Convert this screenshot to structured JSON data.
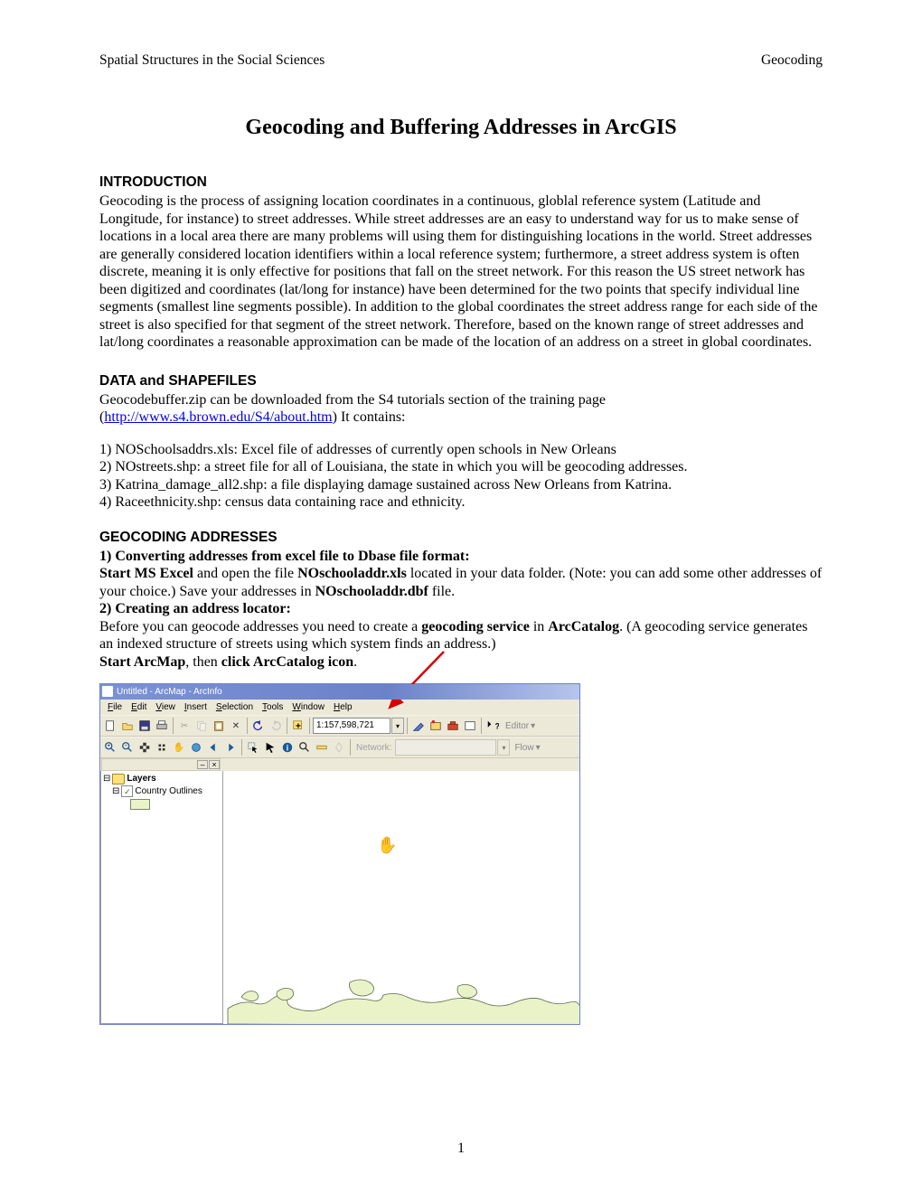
{
  "header": {
    "left": "Spatial Structures in the Social Sciences",
    "right": "Geocoding"
  },
  "title": "Geocoding and Buffering Addresses in ArcGIS",
  "intro_heading": "INTRODUCTION",
  "intro_body": "Geocoding is the process of assigning location coordinates in a continuous, globlal reference system (Latitude and Longitude, for instance) to street addresses. While street addresses are an easy to understand way for us to make sense of locations in a local area there are many problems will using them for distinguishing locations in the world. Street addresses are generally considered location identifiers within a local reference system; furthermore, a street address system is often discrete, meaning it is only effective for positions that fall on the street network. For this reason the US street network has been digitized and coordinates (lat/long for instance) have been determined for the two points that specify individual line segments (smallest line segments possible). In addition to the global coordinates the street address range for each side of the street is also specified for that segment of the street network. Therefore, based on the known range of street addresses and lat/long coordinates a reasonable approximation can be made of the location of an address on a street in global coordinates.",
  "data_heading": "DATA and SHAPEFILES",
  "data_intro_pre": "Geocodebuffer.zip can be downloaded from the S4 tutorials section of the training page (",
  "data_url": "http://www.s4.brown.edu/S4/about.htm",
  "data_intro_post": ") It contains:",
  "data_items": {
    "i1": "1) NOSchoolsaddrs.xls: Excel file of addresses of currently open schools in New Orleans",
    "i2": "2) NOstreets.shp: a street file for all of Louisiana, the state in which you will be geocoding addresses.",
    "i3": "3) Katrina_damage_all2.shp: a file displaying damage sustained across New Orleans from Katrina.",
    "i4": "4) Raceethnicity.shp: census data containing race and ethnicity."
  },
  "geo_heading": "GEOCODING ADDRESSES",
  "step1_title": "1) Converting addresses from excel file to Dbase file format:",
  "step1_b1": "Start MS Excel",
  "step1_t1": " and open the file ",
  "step1_b2": "NOschooladdr.xls",
  "step1_t2": " located in your data folder. (Note: you can add some other addresses of your choice.) Save your addresses in ",
  "step1_b3": "NOschooladdr.dbf",
  "step1_t3": " file.",
  "step2_title": "2) Creating an address locator:",
  "step2_pre": "Before you can geocode addresses you need to create a ",
  "step2_b1": "geocoding service",
  "step2_mid": " in ",
  "step2_b2": "ArcCatalog",
  "step2_post": ". (A geocoding service generates an indexed structure of streets using which system finds an address.)",
  "step3_b1": "Start ArcMap",
  "step3_t1": ", then ",
  "step3_b2": "click ArcCatalog icon",
  "step3_t2": ".",
  "page_number": "1",
  "arcmap": {
    "title": "Untitled - ArcMap - ArcInfo",
    "menus": {
      "File": "File",
      "Edit": "Edit",
      "View": "View",
      "Insert": "Insert",
      "Selection": "Selection",
      "Tools": "Tools",
      "Window": "Window",
      "Help": "Help"
    },
    "scale": "1:157,598,721",
    "editor_label": "Editor",
    "network_label": "Network:",
    "flow_label": "Flow",
    "toc": {
      "layers": "Layers",
      "country": "Country Outlines"
    }
  }
}
